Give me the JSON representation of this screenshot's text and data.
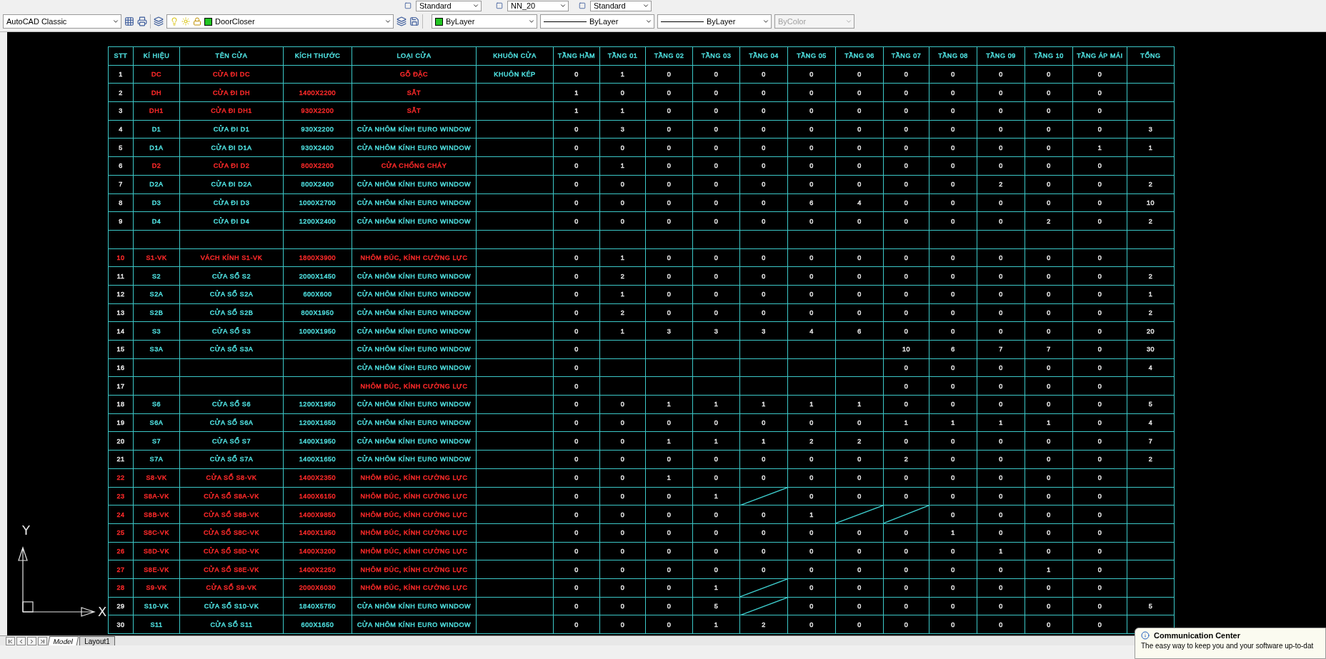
{
  "toolbar_top": {
    "dropdowns": [
      {
        "value": "Standard"
      },
      {
        "value": "NN_20"
      },
      {
        "value": "Standard"
      }
    ]
  },
  "toolbar": {
    "workspace": "AutoCAD Classic",
    "layer": "DoorCloser",
    "properties": [
      {
        "kind": "color",
        "value": "ByLayer",
        "disabled": false
      },
      {
        "kind": "line",
        "value": "ByLayer",
        "disabled": false
      },
      {
        "kind": "line",
        "value": "ByLayer",
        "disabled": false
      },
      {
        "kind": "plain",
        "value": "ByColor",
        "disabled": true
      }
    ]
  },
  "table": {
    "columns": [
      "STT",
      "KÍ HIỆU",
      "TÊN CỬA",
      "KÍCH THƯỚC",
      "LOẠI CỬA",
      "KHUÔN CỬA",
      "TẦNG HẦM",
      "TẦNG 01",
      "TẦNG 02",
      "TẦNG 03",
      "TẦNG 04",
      "TẦNG 05",
      "TẦNG 06",
      "TẦNG 07",
      "TẦNG 08",
      "TẦNG 09",
      "TẦNG 10",
      "TẦNG ÁP MÁI",
      "TỔNG"
    ],
    "rows": [
      {
        "kind": "item",
        "stt": {
          "text": "1",
          "color": "#e6e6e6"
        },
        "color": "#ff2a2a",
        "symbol": "DC",
        "name": "CỬA ĐI DC",
        "type": "GỖ ĐẶC",
        "frame": "KHUÔN KÉP",
        "counts": [
          "0",
          "1",
          "0",
          "0",
          "0",
          "0",
          "0",
          "0",
          "0",
          "0",
          "0",
          "0",
          {
            "kind": "empty"
          }
        ]
      },
      {
        "kind": "item",
        "stt": {
          "text": "2",
          "color": "#e6e6e6"
        },
        "color": "#ff2a2a",
        "symbol": "DH",
        "name": "CỬA ĐI DH",
        "size": "1400X2200",
        "type": "SẮT",
        "counts": [
          "1",
          "0",
          "0",
          "0",
          "0",
          "0",
          "0",
          "0",
          "0",
          "0",
          "0",
          "0",
          {
            "kind": "empty"
          }
        ]
      },
      {
        "kind": "item",
        "stt": {
          "text": "3",
          "color": "#e6e6e6"
        },
        "color": "#ff2a2a",
        "symbol": "DH1",
        "name": "CỬA ĐI DH1",
        "size": "930X2200",
        "type": "SẮT",
        "counts": [
          "1",
          "1",
          "0",
          "0",
          "0",
          "0",
          "0",
          "0",
          "0",
          "0",
          "0",
          "0",
          {
            "kind": "empty"
          }
        ]
      },
      {
        "kind": "item",
        "stt": {
          "text": "4",
          "color": "#e6e6e6"
        },
        "color": "#4fe0e0",
        "symbol": "D1",
        "name": "CỬA ĐI D1",
        "size": "930X2200",
        "type": "CỬA NHÔM KÍNH EURO WINDOW",
        "counts": [
          "0",
          "3",
          "0",
          "0",
          "0",
          "0",
          "0",
          "0",
          "0",
          "0",
          "0",
          "0",
          "3"
        ]
      },
      {
        "kind": "item",
        "stt": {
          "text": "5",
          "color": "#e6e6e6"
        },
        "color": "#4fe0e0",
        "symbol": "D1A",
        "name": "CỬA ĐI D1A",
        "size": "930X2400",
        "type": "CỬA NHÔM KÍNH EURO WINDOW",
        "counts": [
          "0",
          "0",
          "0",
          "0",
          "0",
          "0",
          "0",
          "0",
          "0",
          "0",
          "0",
          "1",
          "1"
        ]
      },
      {
        "kind": "item",
        "stt": {
          "text": "6",
          "color": "#e6e6e6"
        },
        "color": "#ff2a2a",
        "symbol": "D2",
        "name": "CỬA ĐI D2",
        "size": "800X2200",
        "type": "CỬA CHỐNG CHÁY",
        "counts": [
          "0",
          "1",
          "0",
          "0",
          "0",
          "0",
          "0",
          "0",
          "0",
          "0",
          "0",
          "0",
          {
            "kind": "empty"
          }
        ]
      },
      {
        "kind": "item",
        "stt": {
          "text": "7",
          "color": "#e6e6e6"
        },
        "color": "#4fe0e0",
        "symbol": "D2A",
        "name": "CỬA ĐI D2A",
        "size": "800X2400",
        "type": "CỬA NHÔM KÍNH EURO WINDOW",
        "counts": [
          "0",
          "0",
          "0",
          "0",
          "0",
          "0",
          "0",
          "0",
          "0",
          "2",
          "0",
          "0",
          "2"
        ]
      },
      {
        "kind": "item",
        "stt": {
          "text": "8",
          "color": "#e6e6e6"
        },
        "color": "#4fe0e0",
        "symbol": "D3",
        "name": "CỬA ĐI D3",
        "size": "1000X2700",
        "type": "CỬA NHÔM KÍNH EURO WINDOW",
        "counts": [
          "0",
          "0",
          "0",
          "0",
          "0",
          "6",
          "4",
          "0",
          "0",
          "0",
          "0",
          "0",
          "10"
        ]
      },
      {
        "kind": "item",
        "stt": {
          "text": "9",
          "color": "#e6e6e6"
        },
        "color": "#4fe0e0",
        "symbol": "D4",
        "name": "CỬA ĐI D4",
        "size": "1200X2400",
        "type": "CỬA NHÔM KÍNH EURO WINDOW",
        "counts": [
          "0",
          "0",
          "0",
          "0",
          "0",
          "0",
          "0",
          "0",
          "0",
          "0",
          "2",
          "0",
          "2"
        ]
      },
      {
        "kind": "blank"
      },
      {
        "kind": "item",
        "stt": {
          "text": "10",
          "color": "#ff2a2a"
        },
        "color": "#ff2a2a",
        "symbol": "S1-VK",
        "name": "VÁCH KÍNH S1-VK",
        "size": "1800X3900",
        "type": "NHÔM ĐÚC, KÍNH CƯỜNG LỰC",
        "counts": [
          "0",
          "1",
          "0",
          "0",
          "0",
          "0",
          "0",
          "0",
          "0",
          "0",
          "0",
          "0",
          {
            "kind": "empty"
          }
        ]
      },
      {
        "kind": "item",
        "stt": {
          "text": "11",
          "color": "#e6e6e6"
        },
        "color": "#4fe0e0",
        "symbol": "S2",
        "name": "CỬA SỔ S2",
        "size": "2000X1450",
        "type": "CỬA NHÔM KÍNH EURO WINDOW",
        "counts": [
          "0",
          "2",
          "0",
          "0",
          "0",
          "0",
          "0",
          "0",
          "0",
          "0",
          "0",
          "0",
          "2"
        ]
      },
      {
        "kind": "item",
        "stt": {
          "text": "12",
          "color": "#e6e6e6"
        },
        "color": "#4fe0e0",
        "symbol": "S2A",
        "name": "CỬA SỔ S2A",
        "size": "600X600",
        "type": "CỬA NHÔM KÍNH EURO WINDOW",
        "counts": [
          "0",
          "1",
          "0",
          "0",
          "0",
          "0",
          "0",
          "0",
          "0",
          "0",
          "0",
          "0",
          "1"
        ]
      },
      {
        "kind": "item",
        "stt": {
          "text": "13",
          "color": "#e6e6e6"
        },
        "color": "#4fe0e0",
        "symbol": "S2B",
        "name": "CỬA SỔ S2B",
        "size": "800X1950",
        "type": "CỬA NHÔM KÍNH EURO WINDOW",
        "counts": [
          "0",
          "2",
          "0",
          "0",
          "0",
          "0",
          "0",
          "0",
          "0",
          "0",
          "0",
          "0",
          "2"
        ]
      },
      {
        "kind": "item",
        "stt": {
          "text": "14",
          "color": "#e6e6e6"
        },
        "color": "#4fe0e0",
        "symbol": "S3",
        "name": "CỬA SỔ S3",
        "size": "1000X1950",
        "type": "CỬA NHÔM KÍNH EURO WINDOW",
        "counts": [
          "0",
          "1",
          "3",
          "3",
          "3",
          "4",
          "6",
          "0",
          "0",
          "0",
          "0",
          "0",
          "20"
        ]
      },
      {
        "kind": "item",
        "stt": {
          "text": "15",
          "color": "#e6e6e6"
        },
        "color": "#4fe0e0",
        "symbol": "S3A",
        "name": "CỬA SỔ S3A",
        "type": "CỬA NHÔM KÍNH EURO WINDOW",
        "counts": [
          "0",
          {
            "kind": "empty"
          },
          {
            "kind": "empty"
          },
          {
            "kind": "empty"
          },
          {
            "kind": "empty"
          },
          {
            "kind": "empty"
          },
          {
            "kind": "empty"
          },
          "10",
          "6",
          "7",
          "7",
          "0",
          "30"
        ]
      },
      {
        "kind": "item",
        "stt": {
          "text": "16",
          "color": "#e6e6e6"
        },
        "color": "#4fe0e0",
        "type": "CỬA NHÔM KÍNH EURO WINDOW",
        "counts": [
          "0",
          {
            "kind": "empty"
          },
          {
            "kind": "empty"
          },
          {
            "kind": "empty"
          },
          {
            "kind": "empty"
          },
          {
            "kind": "empty"
          },
          {
            "kind": "empty"
          },
          "0",
          "0",
          "0",
          "0",
          "0",
          "4"
        ]
      },
      {
        "kind": "item",
        "stt": {
          "text": "17",
          "color": "#e6e6e6"
        },
        "color": "#ff2a2a",
        "type": "NHÔM ĐÚC, KÍNH CƯỜNG LỰC",
        "counts": [
          "0",
          {
            "kind": "empty"
          },
          {
            "kind": "empty"
          },
          {
            "kind": "empty"
          },
          {
            "kind": "empty"
          },
          {
            "kind": "empty"
          },
          {
            "kind": "empty"
          },
          "0",
          "0",
          "0",
          "0",
          "0",
          {
            "kind": "empty"
          }
        ]
      },
      {
        "kind": "item",
        "stt": {
          "text": "18",
          "color": "#e6e6e6"
        },
        "color": "#4fe0e0",
        "symbol": "S6",
        "name": "CỬA SỔ S6",
        "size": "1200X1950",
        "type": "CỬA NHÔM KÍNH EURO WINDOW",
        "counts": [
          "0",
          "0",
          "1",
          "1",
          "1",
          "1",
          "1",
          "0",
          "0",
          "0",
          "0",
          "0",
          "5"
        ]
      },
      {
        "kind": "item",
        "stt": {
          "text": "19",
          "color": "#e6e6e6"
        },
        "color": "#4fe0e0",
        "symbol": "S6A",
        "name": "CỬA SỔ S6A",
        "size": "1200X1650",
        "type": "CỬA NHÔM KÍNH EURO WINDOW",
        "counts": [
          "0",
          "0",
          "0",
          "0",
          "0",
          "0",
          "0",
          "1",
          "1",
          "1",
          "1",
          "0",
          "4"
        ]
      },
      {
        "kind": "item",
        "stt": {
          "text": "20",
          "color": "#e6e6e6"
        },
        "color": "#4fe0e0",
        "symbol": "S7",
        "name": "CỬA SỔ S7",
        "size": "1400X1950",
        "type": "CỬA NHÔM KÍNH EURO WINDOW",
        "counts": [
          "0",
          "0",
          "1",
          "1",
          "1",
          "2",
          "2",
          "0",
          "0",
          "0",
          "0",
          "0",
          "7"
        ]
      },
      {
        "kind": "item",
        "stt": {
          "text": "21",
          "color": "#e6e6e6"
        },
        "color": "#4fe0e0",
        "symbol": "S7A",
        "name": "CỬA SỔ S7A",
        "size": "1400X1650",
        "type": "CỬA NHÔM KÍNH EURO WINDOW",
        "counts": [
          "0",
          "0",
          "0",
          "0",
          "0",
          "0",
          "0",
          "2",
          "0",
          "0",
          "0",
          "0",
          "2"
        ]
      },
      {
        "kind": "item",
        "stt": {
          "text": "22",
          "color": "#ff2a2a"
        },
        "color": "#ff2a2a",
        "symbol": "S8-VK",
        "name": "CỬA SỔ S8-VK",
        "size": "1400X2350",
        "type": "NHÔM ĐÚC, KÍNH CƯỜNG LỰC",
        "counts": [
          "0",
          "0",
          "1",
          "0",
          "0",
          "0",
          "0",
          "0",
          "0",
          "0",
          "0",
          "0",
          {
            "kind": "empty"
          }
        ]
      },
      {
        "kind": "item",
        "stt": {
          "text": "23",
          "color": "#ff2a2a"
        },
        "color": "#ff2a2a",
        "symbol": "S8A-VK",
        "name": "CỬA SỔ S8A-VK",
        "size": "1400X6150",
        "type": "NHÔM ĐÚC, KÍNH CƯỜNG LỰC",
        "counts": [
          "0",
          "0",
          "0",
          "1",
          {
            "kind": "slash"
          },
          "0",
          "0",
          "0",
          "0",
          "0",
          "0",
          "0",
          {
            "kind": "empty"
          }
        ]
      },
      {
        "kind": "item",
        "stt": {
          "text": "24",
          "color": "#ff2a2a"
        },
        "color": "#ff2a2a",
        "symbol": "S8B-VK",
        "name": "CỬA SỔ S8B-VK",
        "size": "1400X9850",
        "type": "NHÔM ĐÚC, KÍNH CƯỜNG LỰC",
        "counts": [
          "0",
          "0",
          "0",
          "0",
          "0",
          "1",
          {
            "kind": "slash"
          },
          {
            "kind": "slash"
          },
          "0",
          "0",
          "0",
          "0",
          {
            "kind": "empty"
          }
        ]
      },
      {
        "kind": "item",
        "stt": {
          "text": "25",
          "color": "#ff2a2a"
        },
        "color": "#ff2a2a",
        "symbol": "S8C-VK",
        "name": "CỬA SỔ S8C-VK",
        "size": "1400X1950",
        "type": "NHÔM ĐÚC, KÍNH CƯỜNG LỰC",
        "counts": [
          "0",
          "0",
          "0",
          "0",
          "0",
          "0",
          "0",
          "0",
          "1",
          "0",
          "0",
          "0",
          {
            "kind": "empty"
          }
        ]
      },
      {
        "kind": "item",
        "stt": {
          "text": "26",
          "color": "#ff2a2a"
        },
        "color": "#ff2a2a",
        "symbol": "S8D-VK",
        "name": "CỬA SỔ S8D-VK",
        "size": "1400X3200",
        "type": "NHÔM ĐÚC, KÍNH CƯỜNG LỰC",
        "counts": [
          "0",
          "0",
          "0",
          "0",
          "0",
          "0",
          "0",
          "0",
          "0",
          "1",
          "0",
          "0",
          {
            "kind": "empty"
          }
        ]
      },
      {
        "kind": "item",
        "stt": {
          "text": "27",
          "color": "#ff2a2a"
        },
        "color": "#ff2a2a",
        "symbol": "S8E-VK",
        "name": "CỬA SỔ S8E-VK",
        "size": "1400X2250",
        "type": "NHÔM ĐÚC, KÍNH CƯỜNG LỰC",
        "counts": [
          "0",
          "0",
          "0",
          "0",
          "0",
          "0",
          "0",
          "0",
          "0",
          "0",
          "1",
          "0",
          {
            "kind": "empty"
          }
        ]
      },
      {
        "kind": "item",
        "stt": {
          "text": "28",
          "color": "#ff2a2a"
        },
        "color": "#ff2a2a",
        "symbol": "S9-VK",
        "name": "CỬA SỔ S9-VK",
        "size": "2000X6030",
        "type": "NHÔM ĐÚC, KÍNH CƯỜNG LỰC",
        "counts": [
          "0",
          "0",
          "0",
          "1",
          {
            "kind": "slash"
          },
          "0",
          "0",
          "0",
          "0",
          "0",
          "0",
          "0",
          {
            "kind": "empty"
          }
        ]
      },
      {
        "kind": "item",
        "stt": {
          "text": "29",
          "color": "#e6e6e6"
        },
        "color": "#4fe0e0",
        "symbol": "S10-VK",
        "name": "CỬA SỔ S10-VK",
        "size": "1840X5750",
        "type": "CỬA NHÔM KÍNH EURO WINDOW",
        "counts": [
          "0",
          "0",
          "0",
          "5",
          {
            "kind": "slash"
          },
          "0",
          "0",
          "0",
          "0",
          "0",
          "0",
          "0",
          "5"
        ]
      },
      {
        "kind": "item",
        "stt": {
          "text": "30",
          "color": "#e6e6e6"
        },
        "color": "#4fe0e0",
        "symbol": "S11",
        "name": "CỬA SỔ S11",
        "size": "600X1650",
        "type": "CỬA NHÔM KÍNH EURO WINDOW",
        "counts": [
          "0",
          "0",
          "0",
          "1",
          "2",
          "0",
          "0",
          "0",
          "0",
          "0",
          "0",
          "0",
          {
            "kind": "empty"
          }
        ]
      }
    ]
  },
  "ucs": {
    "y_label": "Y",
    "x_label": "X"
  },
  "tabs": [
    {
      "label": "Model",
      "selected": true
    },
    {
      "label": "Layout1",
      "selected": false
    }
  ],
  "notification": {
    "title": "Communication Center",
    "text": "The easy way to keep you and your software up-to-dat"
  }
}
